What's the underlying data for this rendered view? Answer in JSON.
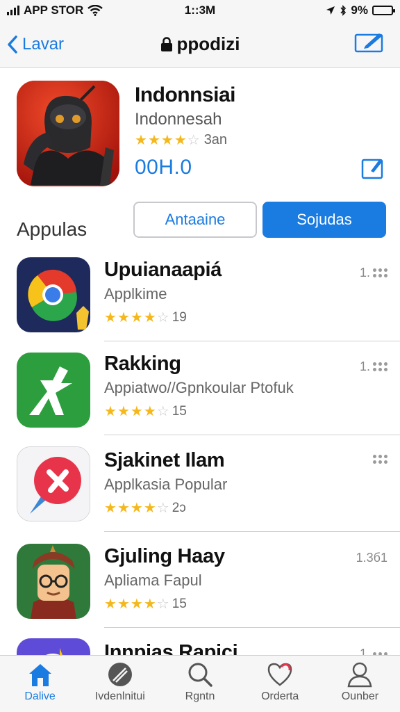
{
  "status_bar": {
    "carrier": "APP STOR",
    "time": "1::3M",
    "battery": "9%",
    "battery_level": 0.9
  },
  "nav": {
    "back_label": "Lavar",
    "title": "ppodizi"
  },
  "featured": {
    "title": "Indonnsiai",
    "subtitle": "Indonnesah",
    "rating_count": "3an",
    "stars": 4,
    "price": "00H.0"
  },
  "segment": {
    "section_title": "Appulas",
    "left_label": "Antaaine",
    "right_label": "Sojudas"
  },
  "apps": [
    {
      "name": "Upuianaapiá",
      "desc": "Applkime",
      "stars": 4,
      "count": "19",
      "meta": "1.",
      "colors": {
        "bg": "#1f2a5c"
      }
    },
    {
      "name": "Rakking",
      "desc": "Appiatwo//Gpnkoular Ptofuk",
      "stars": 4,
      "count": "15",
      "meta": "1.",
      "colors": {
        "bg": "#2c9e3e"
      }
    },
    {
      "name": "Sjakinet Ilam",
      "desc": "Applkasia Popular",
      "stars": 4,
      "count": "2ɔ",
      "meta": "",
      "colors": {
        "bg": "#f1f1f3"
      }
    },
    {
      "name": "Gjuling Haay",
      "desc": "Apliama Fapul",
      "stars": 4,
      "count": "15",
      "meta": "1.3б1",
      "colors": {
        "bg": "#2f7a3a"
      }
    },
    {
      "name": "Innpias Rapiçi",
      "desc": "",
      "stars": 0,
      "count": "",
      "meta": "1.",
      "colors": {
        "bg": "#5e4bd8"
      }
    }
  ],
  "tabs": [
    {
      "label": "Dalive",
      "icon": "home-icon"
    },
    {
      "label": "Ivdenlnitui",
      "icon": "compass-icon"
    },
    {
      "label": "Rgntn",
      "icon": "search-icon"
    },
    {
      "label": "Orderta",
      "icon": "heart-icon"
    },
    {
      "label": "Ounber",
      "icon": "person-icon"
    }
  ],
  "accent_color": "#1a7be0",
  "star_color": "#f5b81c"
}
